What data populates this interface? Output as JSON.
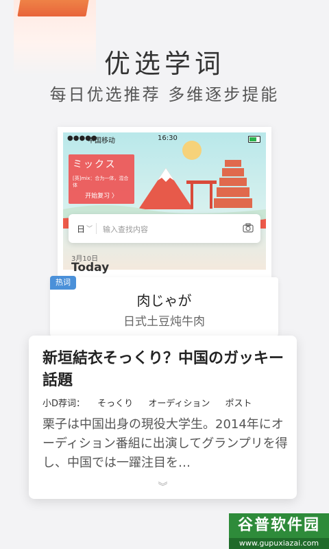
{
  "header": {
    "headline": "优选学词",
    "subline": "每日优选推荐   多维逐步提能"
  },
  "phone": {
    "status": {
      "dots": "●●●●●",
      "carrier": "中国移动",
      "time": "16:30"
    },
    "word_card": {
      "title": "ミックス",
      "definition": "[英]mix：合为一体，混合体",
      "review_label": "开始复习 〉"
    },
    "search": {
      "lang": "日",
      "placeholder": "输入查找内容"
    },
    "date_small": "3月10日",
    "date_big": "Today"
  },
  "hot": {
    "tag": "热词",
    "word": "肉じゃが",
    "meaning": "日式土豆炖牛肉"
  },
  "article": {
    "title": "新垣結衣そっくり？中国のガッキー話題",
    "tags_label": "小D荐词：",
    "tags": [
      "そっくり",
      "オーディション",
      "ポスト"
    ],
    "body": "栗子は中国出身の現役大学生。2014年にオーディション番組に出演してグランプリを得し、中国では一躍注目を…",
    "expand_icon": "chevron-down-double-icon"
  },
  "watermark": {
    "logo": "谷普软件园",
    "url": "www.gupuxiazai.com"
  },
  "colors": {
    "accent_red": "#e85555",
    "tag_blue": "#4a90d9",
    "watermark_green": "#2e8b3a"
  }
}
